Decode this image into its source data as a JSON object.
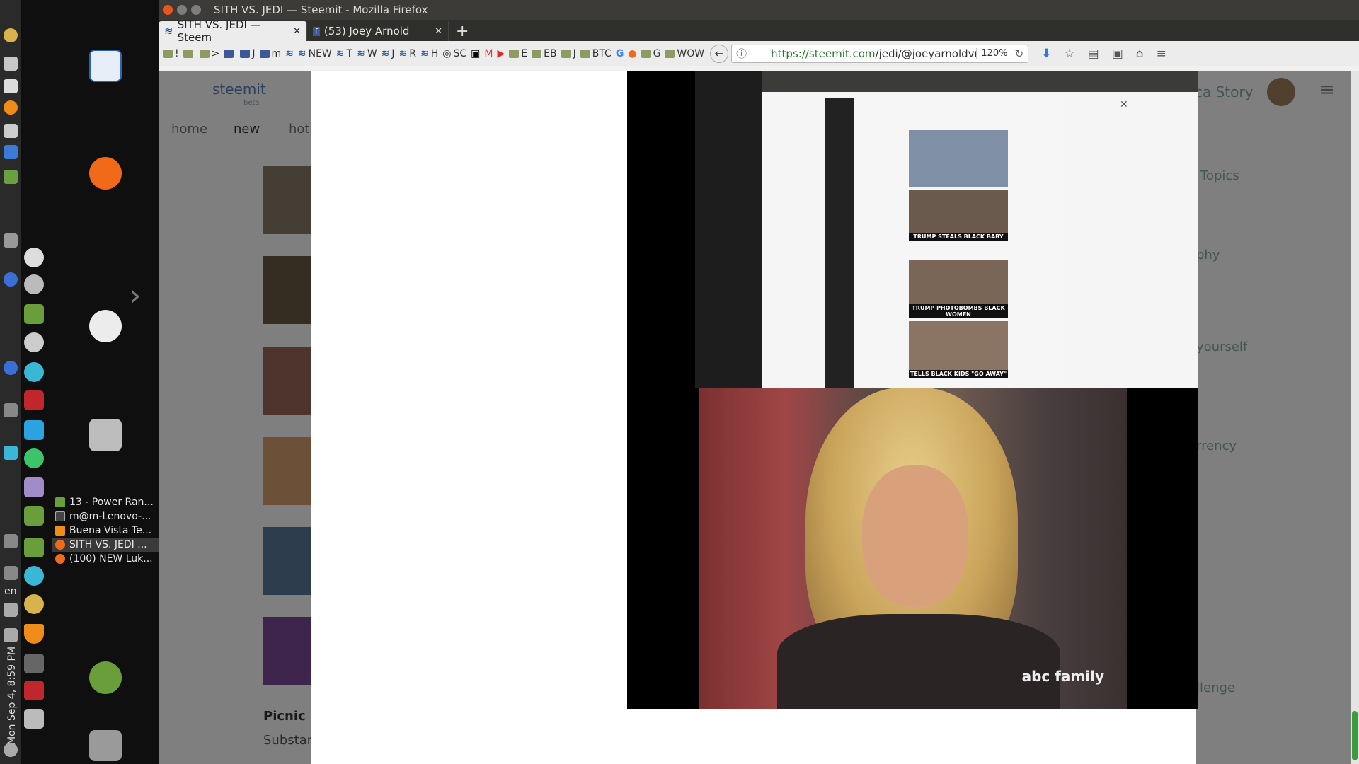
{
  "window": {
    "title": "SITH VS. JEDI — Steemit - Mozilla Firefox"
  },
  "tabs": [
    {
      "label": "SITH VS. JEDI — Steem",
      "active": true
    },
    {
      "label": "(53) Joey Arnold",
      "active": false
    }
  ],
  "bookmarks": [
    "!",
    ">",
    "J",
    "m",
    "NEW",
    "T",
    "W",
    "J",
    "R",
    "H",
    "SC",
    "E",
    "EB",
    "J",
    "BTC",
    "G",
    "G",
    "WOW"
  ],
  "urlbar": {
    "url_host": "https://steemit.com",
    "url_path": "/jedi/@joeyarnoldvn/sith-",
    "zoom": "120%"
  },
  "system": {
    "clock": "Mon Sep 4, 8:59 PM",
    "language": "en"
  },
  "taskbar": [
    {
      "label": "13 - Power Ran...",
      "active": false
    },
    {
      "label": "m@m-Lenovo-...",
      "active": false
    },
    {
      "label": "Buena Vista Te...",
      "active": false
    },
    {
      "label": "SITH VS. JEDI ...",
      "active": true
    },
    {
      "label": "(100) NEW Luk...",
      "active": false
    }
  ],
  "page": {
    "logo": "steemit",
    "logo_sub": "beta",
    "nav": [
      "home",
      "new",
      "hot"
    ],
    "side_links": [
      "ca Story",
      "Topics",
      "phy",
      "yourself",
      "rrency",
      "llenge"
    ],
    "post_title": "Picnic S",
    "post_excerpt": "Substan"
  },
  "modal": {
    "close_label": "×",
    "nested_captions": [
      "TRUMP STEALS BLACK BABY",
      "TRUMP PHOTOBOMBS BLACK WOMEN",
      "TELLS BLACK KIDS \"GO AWAY\""
    ],
    "watermark": "abc family"
  },
  "colors": {
    "titlebar": "#3c3b37",
    "scroll_thumb": "#3d9a3d",
    "url_green": "#267a2a"
  }
}
